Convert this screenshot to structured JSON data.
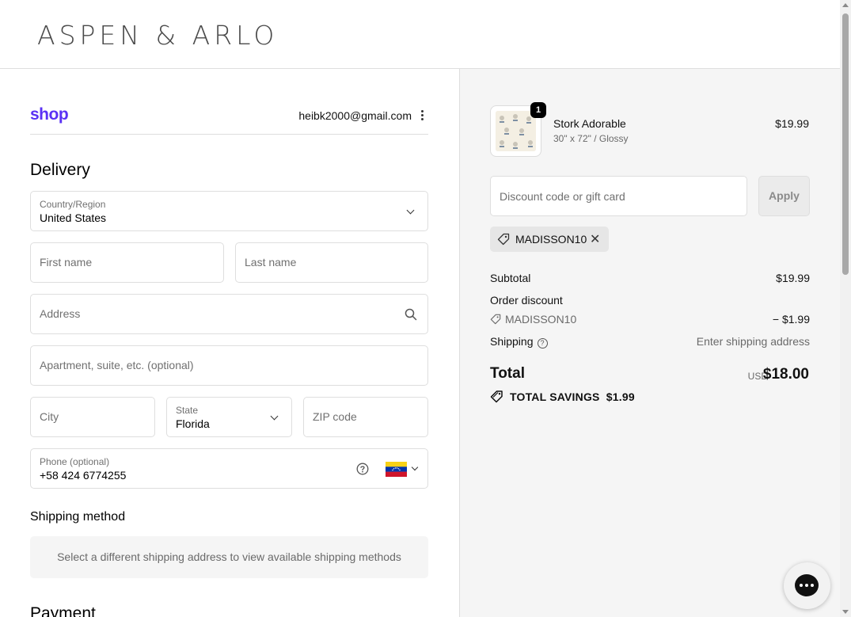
{
  "header": {
    "logo": "ASPEN & ARLO"
  },
  "shop_bar": {
    "brand": "shop",
    "email": "heibk2000@gmail.com"
  },
  "delivery": {
    "title": "Delivery",
    "country": {
      "label": "Country/Region",
      "value": "United States"
    },
    "first_name": {
      "placeholder": "First name"
    },
    "last_name": {
      "placeholder": "Last name"
    },
    "address": {
      "placeholder": "Address"
    },
    "apartment": {
      "placeholder": "Apartment, suite, etc. (optional)"
    },
    "city": {
      "placeholder": "City"
    },
    "state": {
      "label": "State",
      "value": "Florida"
    },
    "zip": {
      "placeholder": "ZIP code"
    },
    "phone": {
      "label": "Phone (optional)",
      "value": "+58 424 6774255"
    }
  },
  "shipping_method": {
    "title": "Shipping method",
    "message": "Select a different shipping address to view available shipping methods"
  },
  "payment": {
    "title": "Payment"
  },
  "order": {
    "item": {
      "quantity": "1",
      "name": "Stork Adorable",
      "variant": "30\" x 72\" / Glossy",
      "price": "$19.99"
    },
    "discount_placeholder": "Discount code or gift card",
    "apply_label": "Apply",
    "applied_code": "MADISSON10",
    "subtotal_label": "Subtotal",
    "subtotal_value": "$19.99",
    "order_discount_label": "Order discount",
    "discount_code": "MADISSON10",
    "discount_value": "− $1.99",
    "shipping_label": "Shipping",
    "shipping_value": "Enter shipping address",
    "total_label": "Total",
    "total_currency": "USD",
    "total_value": "$18.00",
    "savings_label": "TOTAL SAVINGS",
    "savings_value": "$1.99"
  },
  "icons": {
    "menu": "kebab-menu-icon",
    "chevron": "chevron-down-icon",
    "search": "search-icon",
    "help": "help-circle-icon",
    "flag": "venezuela-flag-icon",
    "tag": "tag-icon",
    "remove": "close-icon",
    "chat": "chat-icon"
  },
  "colors": {
    "shop_brand": "#5a31f4",
    "summary_bg": "#f5f5f5",
    "border": "#dedede"
  }
}
